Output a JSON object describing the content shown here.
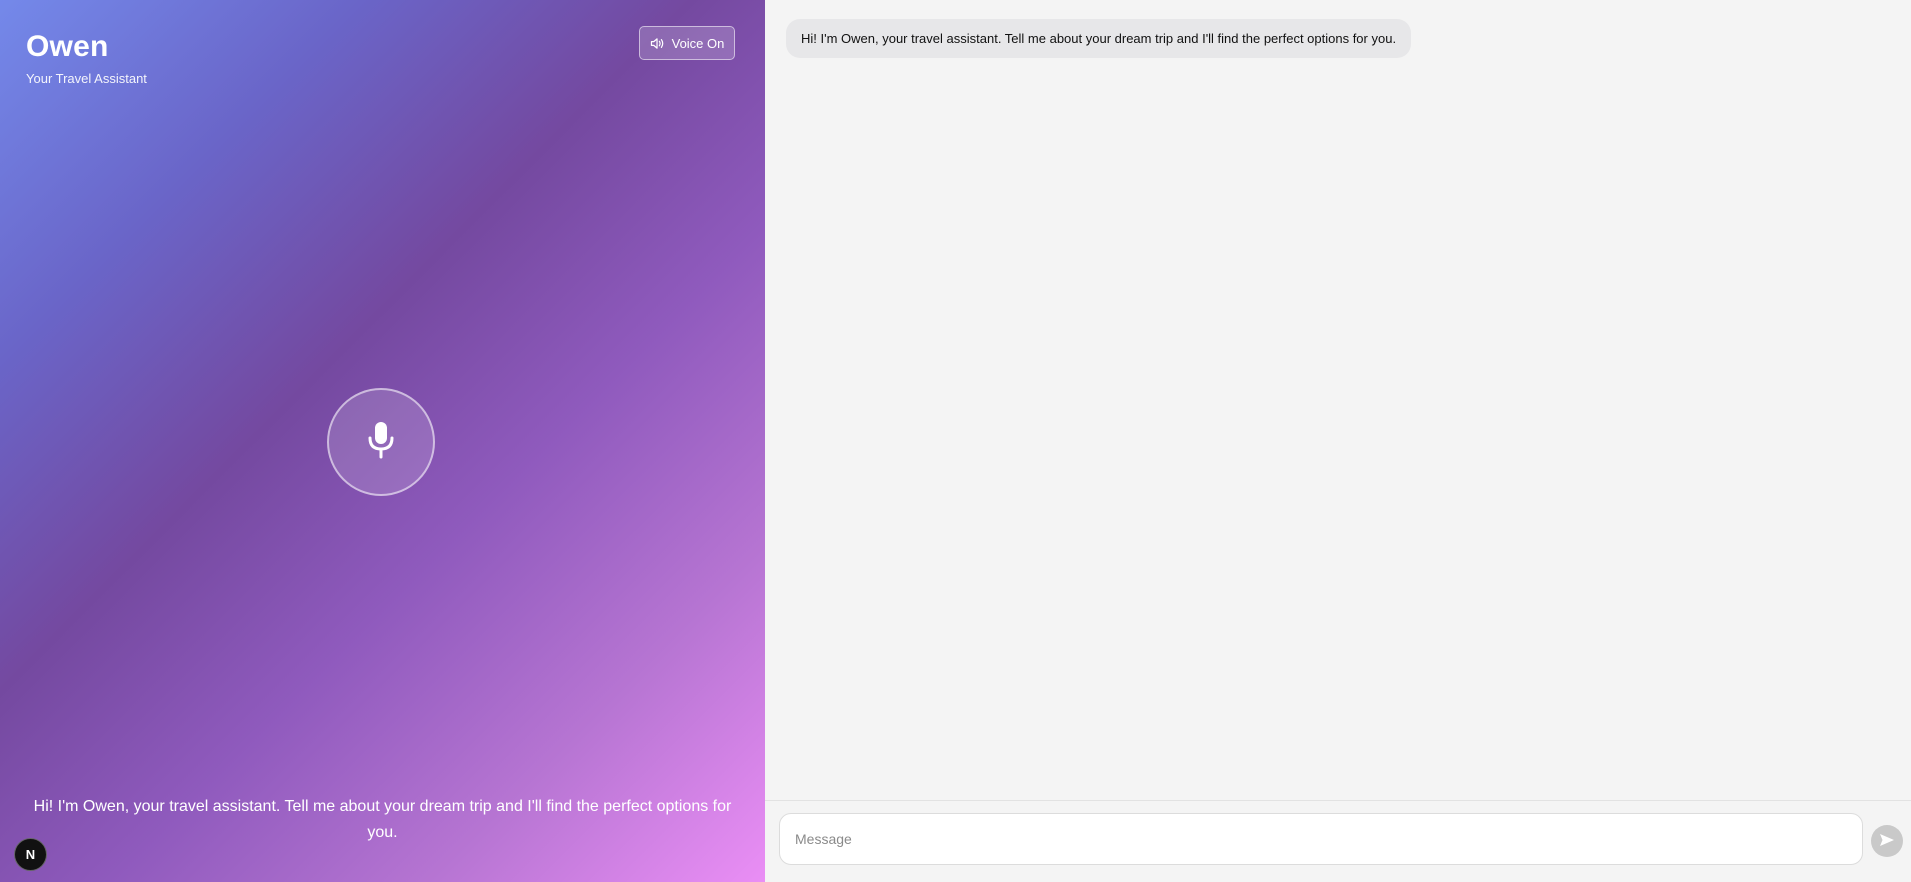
{
  "voice_panel": {
    "title": "Owen",
    "subtitle": "Your Travel Assistant",
    "voice_toggle_label": "Voice On",
    "transcript": "Hi! I'm Owen, your travel assistant. Tell me about your dream trip and I'll find the perfect options for you.",
    "corner_badge_letter": "N",
    "icons": {
      "voice_toggle": "speaker-icon",
      "mic": "microphone-icon"
    }
  },
  "chat": {
    "messages": [
      {
        "role": "assistant",
        "text": "Hi! I'm Owen, your travel assistant. Tell me about your dream trip and I'll find the perfect options for you."
      }
    ],
    "composer": {
      "placeholder": "Message",
      "value": "",
      "send_icon": "send-icon"
    }
  },
  "colors": {
    "gradient_start": "#7489ea",
    "gradient_mid": "#7449a0",
    "gradient_end": "#ea8ef5",
    "chat_background": "#f4f4f4",
    "bubble_background": "#e7e7e9",
    "send_button": "#c9c9c9"
  }
}
